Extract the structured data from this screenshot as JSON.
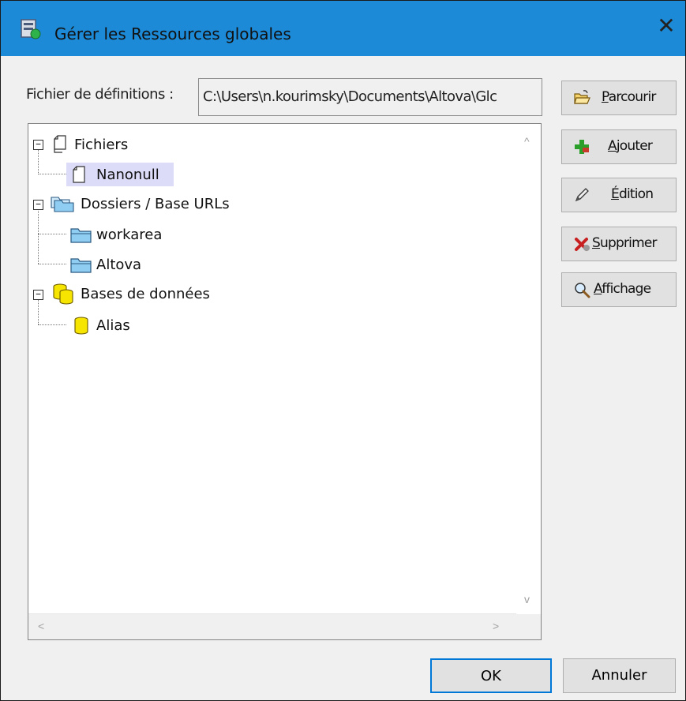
{
  "window": {
    "title": "Gérer les Ressources globales",
    "close_glyph": "✕"
  },
  "definitions": {
    "label": "Fichier de définitions :",
    "path_value": "C:\\Users\\n.kourimsky\\Documents\\Altova\\Glc"
  },
  "side_buttons": {
    "browse": {
      "mnemonic": "P",
      "rest": "arcourir",
      "icon": "open-folder-icon"
    },
    "add": {
      "mnemonic": "A",
      "rest": "jouter",
      "icon": "plus-icon"
    },
    "edit": {
      "mnemonic": "É",
      "rest": "dition",
      "icon": "pencil-icon"
    },
    "delete": {
      "mnemonic": "S",
      "rest": "upprimer",
      "icon": "delete-x-icon"
    },
    "view": {
      "mnemonic": "A",
      "rest": "ffichage",
      "icon": "magnifier-icon"
    }
  },
  "tree": {
    "files": {
      "label": "Fichiers",
      "expander": "−",
      "children": [
        {
          "label": "Nanonull",
          "selected": true
        }
      ]
    },
    "folders": {
      "label": "Dossiers / Base URLs",
      "expander": "−",
      "children": [
        {
          "label": "workarea"
        },
        {
          "label": "Altova"
        }
      ]
    },
    "databases": {
      "label": "Bases de données",
      "expander": "−",
      "children": [
        {
          "label": "Alias"
        }
      ]
    }
  },
  "scroll_arrows": {
    "up": "^",
    "down": "v",
    "left": "<",
    "right": ">"
  },
  "footer": {
    "ok_label": "OK",
    "cancel_label": "Annuler"
  },
  "colors": {
    "titlebar": "#1c8ad6",
    "selection": "#dcdcf8",
    "folder": "#7ec8f0",
    "database": "#f6e500",
    "ok_border": "#0078d7"
  }
}
